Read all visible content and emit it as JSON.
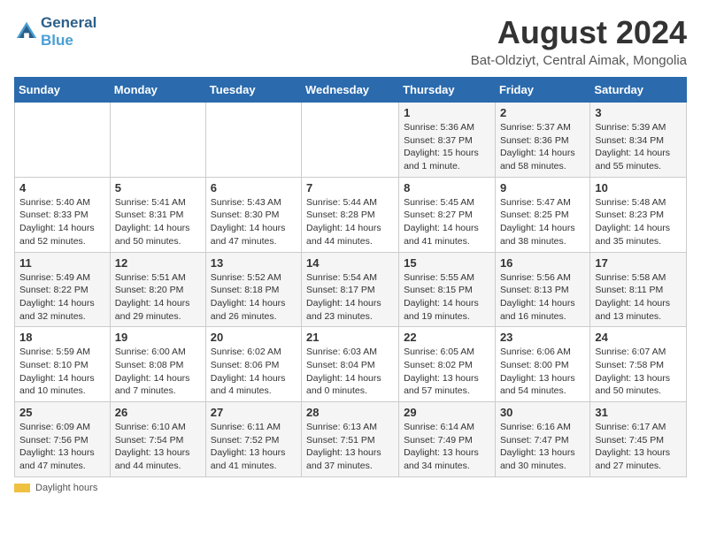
{
  "header": {
    "logo_line1": "General",
    "logo_line2": "Blue",
    "month_year": "August 2024",
    "location": "Bat-Oldziyt, Central Aimak, Mongolia"
  },
  "weekdays": [
    "Sunday",
    "Monday",
    "Tuesday",
    "Wednesday",
    "Thursday",
    "Friday",
    "Saturday"
  ],
  "weeks": [
    [
      {
        "day": "",
        "info": ""
      },
      {
        "day": "",
        "info": ""
      },
      {
        "day": "",
        "info": ""
      },
      {
        "day": "",
        "info": ""
      },
      {
        "day": "1",
        "info": "Sunrise: 5:36 AM\nSunset: 8:37 PM\nDaylight: 15 hours\nand 1 minute."
      },
      {
        "day": "2",
        "info": "Sunrise: 5:37 AM\nSunset: 8:36 PM\nDaylight: 14 hours\nand 58 minutes."
      },
      {
        "day": "3",
        "info": "Sunrise: 5:39 AM\nSunset: 8:34 PM\nDaylight: 14 hours\nand 55 minutes."
      }
    ],
    [
      {
        "day": "4",
        "info": "Sunrise: 5:40 AM\nSunset: 8:33 PM\nDaylight: 14 hours\nand 52 minutes."
      },
      {
        "day": "5",
        "info": "Sunrise: 5:41 AM\nSunset: 8:31 PM\nDaylight: 14 hours\nand 50 minutes."
      },
      {
        "day": "6",
        "info": "Sunrise: 5:43 AM\nSunset: 8:30 PM\nDaylight: 14 hours\nand 47 minutes."
      },
      {
        "day": "7",
        "info": "Sunrise: 5:44 AM\nSunset: 8:28 PM\nDaylight: 14 hours\nand 44 minutes."
      },
      {
        "day": "8",
        "info": "Sunrise: 5:45 AM\nSunset: 8:27 PM\nDaylight: 14 hours\nand 41 minutes."
      },
      {
        "day": "9",
        "info": "Sunrise: 5:47 AM\nSunset: 8:25 PM\nDaylight: 14 hours\nand 38 minutes."
      },
      {
        "day": "10",
        "info": "Sunrise: 5:48 AM\nSunset: 8:23 PM\nDaylight: 14 hours\nand 35 minutes."
      }
    ],
    [
      {
        "day": "11",
        "info": "Sunrise: 5:49 AM\nSunset: 8:22 PM\nDaylight: 14 hours\nand 32 minutes."
      },
      {
        "day": "12",
        "info": "Sunrise: 5:51 AM\nSunset: 8:20 PM\nDaylight: 14 hours\nand 29 minutes."
      },
      {
        "day": "13",
        "info": "Sunrise: 5:52 AM\nSunset: 8:18 PM\nDaylight: 14 hours\nand 26 minutes."
      },
      {
        "day": "14",
        "info": "Sunrise: 5:54 AM\nSunset: 8:17 PM\nDaylight: 14 hours\nand 23 minutes."
      },
      {
        "day": "15",
        "info": "Sunrise: 5:55 AM\nSunset: 8:15 PM\nDaylight: 14 hours\nand 19 minutes."
      },
      {
        "day": "16",
        "info": "Sunrise: 5:56 AM\nSunset: 8:13 PM\nDaylight: 14 hours\nand 16 minutes."
      },
      {
        "day": "17",
        "info": "Sunrise: 5:58 AM\nSunset: 8:11 PM\nDaylight: 14 hours\nand 13 minutes."
      }
    ],
    [
      {
        "day": "18",
        "info": "Sunrise: 5:59 AM\nSunset: 8:10 PM\nDaylight: 14 hours\nand 10 minutes."
      },
      {
        "day": "19",
        "info": "Sunrise: 6:00 AM\nSunset: 8:08 PM\nDaylight: 14 hours\nand 7 minutes."
      },
      {
        "day": "20",
        "info": "Sunrise: 6:02 AM\nSunset: 8:06 PM\nDaylight: 14 hours\nand 4 minutes."
      },
      {
        "day": "21",
        "info": "Sunrise: 6:03 AM\nSunset: 8:04 PM\nDaylight: 14 hours\nand 0 minutes."
      },
      {
        "day": "22",
        "info": "Sunrise: 6:05 AM\nSunset: 8:02 PM\nDaylight: 13 hours\nand 57 minutes."
      },
      {
        "day": "23",
        "info": "Sunrise: 6:06 AM\nSunset: 8:00 PM\nDaylight: 13 hours\nand 54 minutes."
      },
      {
        "day": "24",
        "info": "Sunrise: 6:07 AM\nSunset: 7:58 PM\nDaylight: 13 hours\nand 50 minutes."
      }
    ],
    [
      {
        "day": "25",
        "info": "Sunrise: 6:09 AM\nSunset: 7:56 PM\nDaylight: 13 hours\nand 47 minutes."
      },
      {
        "day": "26",
        "info": "Sunrise: 6:10 AM\nSunset: 7:54 PM\nDaylight: 13 hours\nand 44 minutes."
      },
      {
        "day": "27",
        "info": "Sunrise: 6:11 AM\nSunset: 7:52 PM\nDaylight: 13 hours\nand 41 minutes."
      },
      {
        "day": "28",
        "info": "Sunrise: 6:13 AM\nSunset: 7:51 PM\nDaylight: 13 hours\nand 37 minutes."
      },
      {
        "day": "29",
        "info": "Sunrise: 6:14 AM\nSunset: 7:49 PM\nDaylight: 13 hours\nand 34 minutes."
      },
      {
        "day": "30",
        "info": "Sunrise: 6:16 AM\nSunset: 7:47 PM\nDaylight: 13 hours\nand 30 minutes."
      },
      {
        "day": "31",
        "info": "Sunrise: 6:17 AM\nSunset: 7:45 PM\nDaylight: 13 hours\nand 27 minutes."
      }
    ]
  ],
  "footer": {
    "daylight_label": "Daylight hours"
  }
}
